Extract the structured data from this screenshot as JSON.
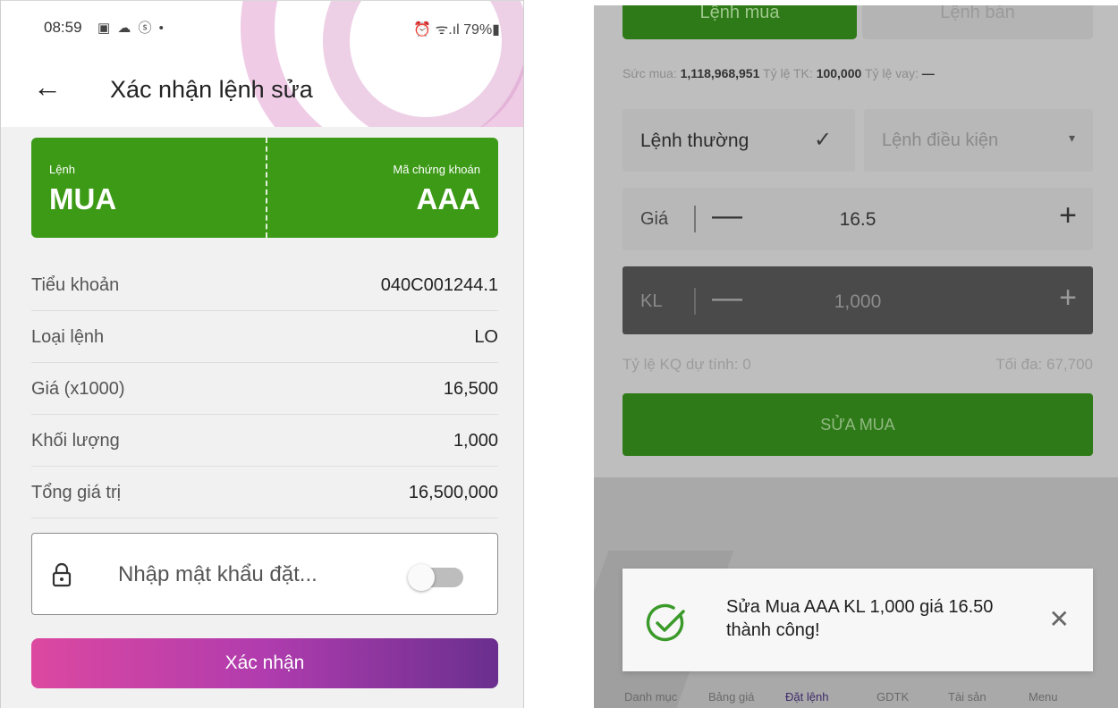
{
  "left_screen": {
    "status_bar": {
      "time": "08:59",
      "icons": "▣ ☁ ⓢ •",
      "right": "⏰ ᯤ.ıl 79%▮"
    },
    "header": {
      "title": "Xác nhận lệnh sửa"
    },
    "order_card": {
      "side_label": "Lệnh",
      "side_value": "MUA",
      "symbol_label": "Mã chứng khoán",
      "symbol_value": "AAA"
    },
    "details": [
      {
        "label": "Tiểu khoản",
        "value": "040C001244.1"
      },
      {
        "label": "Loại lệnh",
        "value": "LO"
      },
      {
        "label": "Giá (x1000)",
        "value": "16,500"
      },
      {
        "label": "Khối lượng",
        "value": "1,000"
      },
      {
        "label": "Tổng giá trị",
        "value": "16,500,000"
      }
    ],
    "password": {
      "placeholder": "Nhập mật khẩu đặt...",
      "toggle_on": false
    },
    "confirm_button": "Xác nhận",
    "colors": {
      "card_green": "#3c9a16",
      "button_gradient_start": "#dc48a0",
      "button_gradient_end": "#6a2f8e"
    }
  },
  "right_screen": {
    "tabs": {
      "buy": "Lệnh mua",
      "sell": "Lệnh bán"
    },
    "buying_power": {
      "label": "Sức mua:",
      "value": "1,118,968,951",
      "ratio_label": "Tỷ lệ TK:",
      "ratio_value": "100,000",
      "loan_label": "Tỷ lệ vay:",
      "loan_value": "—"
    },
    "order_type": {
      "selected": "Lệnh thường",
      "conditional": "Lệnh điều kiện"
    },
    "price": {
      "label": "Giá",
      "value": "16.5",
      "minus": "—",
      "plus": "+"
    },
    "quantity": {
      "label": "KL",
      "value": "1,000",
      "minus": "—",
      "plus": "+"
    },
    "expected_ratio": "Tỷ lệ KQ dự tính: 0",
    "max": "Tối đa: 67,700",
    "submit_button": "SỬA MUA",
    "toast": {
      "message": "Sửa Mua AAA KL 1,000 giá 16.50 thành công!",
      "close": "✕"
    },
    "bottom_nav": [
      "Danh mục",
      "Bảng giá",
      "Đặt lệnh",
      "GDTK",
      "Tài sản",
      "Menu"
    ],
    "bottom_nav_active": "Đặt lệnh",
    "colors": {
      "primary_green": "#2f7a18",
      "toast_check_green": "#3a9a2a"
    }
  }
}
